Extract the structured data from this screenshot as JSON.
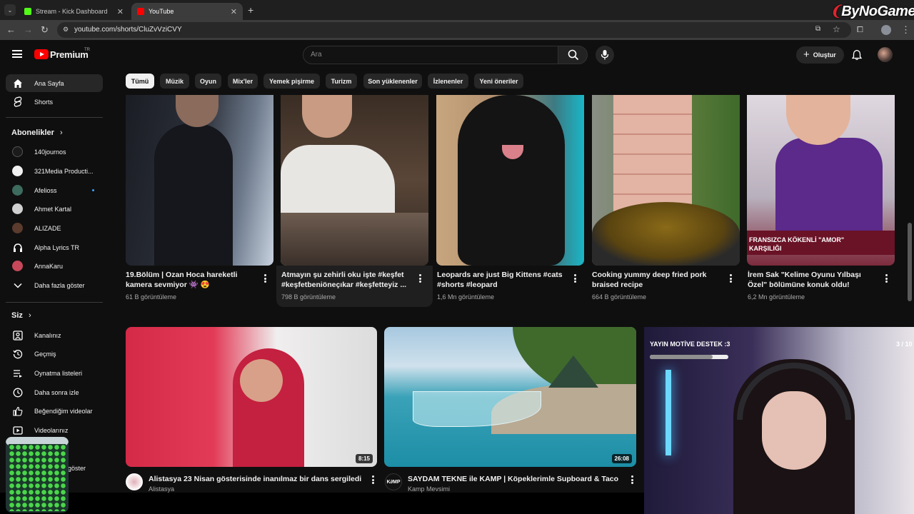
{
  "browser": {
    "tabs": [
      {
        "title": "Stream - Kick Dashboard",
        "favicon_color": "#53fc18",
        "active": false
      },
      {
        "title": "YouTube",
        "favicon_color": "#ff0000",
        "active": true
      }
    ],
    "new_tab": "+",
    "url": "youtube.com/shorts/CluZvVziCVY"
  },
  "overlay": {
    "brand": "ByNoGame",
    "stream_goal_text": "YAYIN MOTİVE DESTEK :3",
    "stream_goal_progress": 0.8,
    "counter": "3 / 10"
  },
  "header": {
    "logo": "Premium",
    "region": "TR",
    "search_placeholder": "Ara",
    "create_label": "Oluştur"
  },
  "chips": [
    "Tümü",
    "Müzik",
    "Oyun",
    "Mix'ler",
    "Yemek pişirme",
    "Turizm",
    "Son yüklenenler",
    "İzlenenler",
    "Yeni öneriler"
  ],
  "sidebar": {
    "main": [
      {
        "label": "Ana Sayfa",
        "icon": "home-icon"
      },
      {
        "label": "Shorts",
        "icon": "shorts-icon"
      }
    ],
    "subs_heading": "Abonelikler",
    "subscriptions": [
      {
        "label": "140journos",
        "color": "#1b1b1b",
        "live": false
      },
      {
        "label": "321Media Producti...",
        "color": "#f1f1f1",
        "live": false
      },
      {
        "label": "Afelioss",
        "color": "#3d6b5e",
        "live": true
      },
      {
        "label": "Ahmet Kartal",
        "color": "#d0d0d0",
        "live": false
      },
      {
        "label": "ALIZADE",
        "color": "#5a3b2e",
        "live": false
      },
      {
        "label": "Alpha Lyrics TR",
        "color": "#ffffff",
        "live": false
      },
      {
        "label": "AnnaKaru",
        "color": "#c7485a",
        "live": false
      }
    ],
    "show_more": "Daha fazla göster",
    "you_heading": "Siz",
    "you_items": [
      {
        "label": "Kanalınız",
        "icon": "channel-icon"
      },
      {
        "label": "Geçmiş",
        "icon": "history-icon"
      },
      {
        "label": "Oynatma listeleri",
        "icon": "playlist-icon"
      },
      {
        "label": "Daha sonra izle",
        "icon": "clock-icon"
      },
      {
        "label": "Beğendiğim videolar",
        "icon": "thumbs-up-icon"
      },
      {
        "label": "Videolarınız",
        "icon": "video-icon"
      }
    ],
    "partial_label": "göster"
  },
  "shorts": [
    {
      "title": "19.Bölüm | Ozan Hoca hareketli kamera sevmiyor 👾 😍",
      "views": "61 B görüntüleme"
    },
    {
      "title": "Atmayın şu zehirli oku işte #keşfet #keşfetbeniöneçıkar #keşfetteyiz ...",
      "views": "798 B görüntüleme"
    },
    {
      "title": "Leopards are just Big Kittens #cats #shorts #leopard",
      "views": "1,6 Mn görüntüleme"
    },
    {
      "title": "Cooking yummy deep fried pork braised recipe",
      "views": "664 B görüntüleme"
    },
    {
      "title": "İrem Sak \"Kelime Oyunu Yılbaşı Özel\" bölümüne konuk oldu!",
      "views": "6,2 Mn görüntüleme",
      "overlay": "FRANSIZCA KÖKENLİ \"AMOR\" KARŞILIĞI"
    }
  ],
  "videos": [
    {
      "title": "Alistasya 23 Nisan gösterisinde inanılmaz bir dans sergiledi",
      "channel": "Alistasya",
      "duration": "8:15"
    },
    {
      "title": "SAYDAM TEKNE ile KAMP | Köpeklerimle Supboard & Taco",
      "channel": "Kamp Mevsimi",
      "duration": "26:08",
      "channel_logo": "K∂MP"
    }
  ],
  "colors": {
    "accent": "#ff0000",
    "bg": "#0f0f0f",
    "chip": "#272727"
  }
}
